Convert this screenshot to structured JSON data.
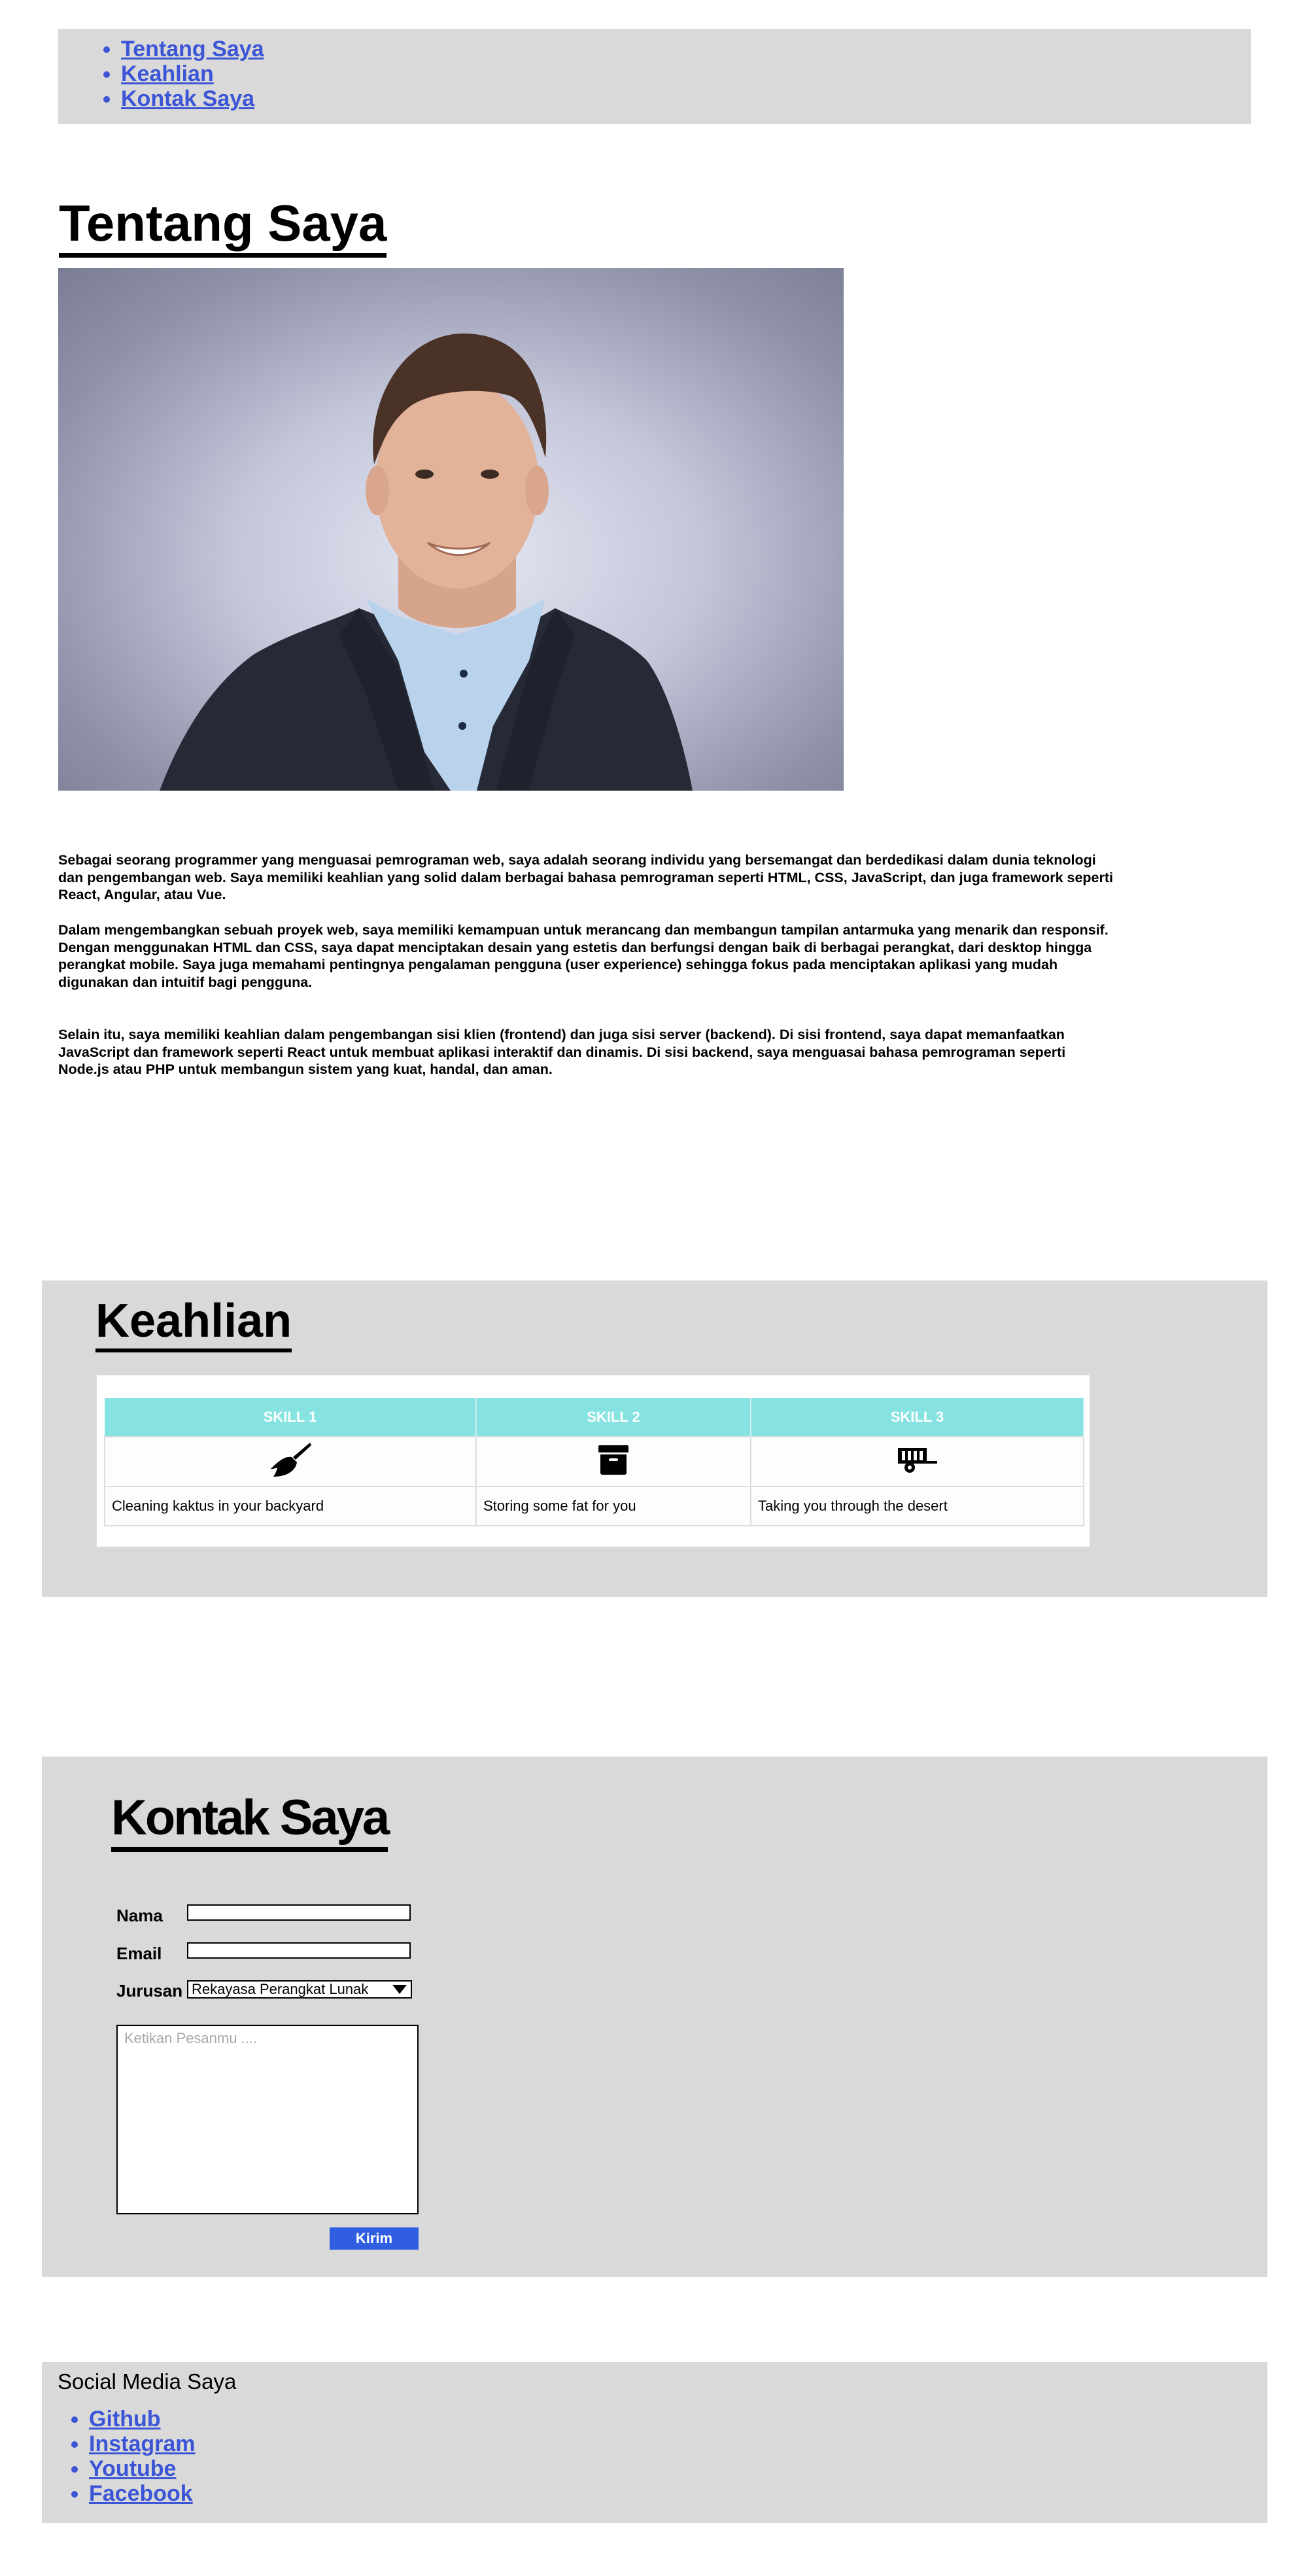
{
  "nav": {
    "items": [
      {
        "label": "Tentang Saya"
      },
      {
        "label": "Keahlian"
      },
      {
        "label": "Kontak Saya"
      }
    ]
  },
  "about": {
    "title": "Tentang Saya",
    "paragraphs": [
      "Sebagai seorang programmer yang menguasai pemrograman web, saya adalah seorang individu yang bersemangat dan berdedikasi dalam dunia teknologi dan pengembangan web. Saya memiliki keahlian yang solid dalam berbagai bahasa pemrograman seperti HTML, CSS, JavaScript, dan juga framework seperti React, Angular, atau Vue.",
      "Dalam mengembangkan sebuah proyek web, saya memiliki kemampuan untuk merancang dan membangun tampilan antarmuka yang menarik dan responsif. Dengan menggunakan HTML dan CSS, saya dapat menciptakan desain yang estetis dan berfungsi dengan baik di berbagai perangkat, dari desktop hingga perangkat mobile. Saya juga memahami pentingnya pengalaman pengguna (user experience) sehingga fokus pada menciptakan aplikasi yang mudah digunakan dan intuitif bagi pengguna.",
      "Selain itu, saya memiliki keahlian dalam pengembangan sisi klien (frontend) dan juga sisi server (backend). Di sisi frontend, saya dapat memanfaatkan JavaScript dan framework seperti React untuk membuat aplikasi interaktif dan dinamis. Di sisi backend, saya menguasai bahasa pemrograman seperti Node.js atau PHP untuk membangun sistem yang kuat, handal, dan aman."
    ]
  },
  "skills": {
    "title": "Keahlian",
    "header_color": "#86e3e1",
    "columns": [
      {
        "header": "SKILL 1",
        "icon": "broom-icon",
        "desc": "Cleaning kaktus in your backyard"
      },
      {
        "header": "SKILL 2",
        "icon": "archive-box-icon",
        "desc": "Storing some fat for you"
      },
      {
        "header": "SKILL 3",
        "icon": "trailer-icon",
        "desc": "Taking you through the desert"
      }
    ]
  },
  "contact": {
    "title": "Kontak Saya",
    "name_label": "Nama",
    "name_value": "",
    "email_label": "Email",
    "email_value": "",
    "major_label": "Jurusan",
    "major_selected": "Rekayasa Perangkat Lunak",
    "message_placeholder": "Ketikan Pesanmu ....",
    "submit_label": "Kirim",
    "submit_color": "#2f5fe0"
  },
  "social": {
    "title": "Social Media Saya",
    "links": [
      {
        "label": "Github"
      },
      {
        "label": "Instagram"
      },
      {
        "label": "Youtube"
      },
      {
        "label": "Facebook"
      }
    ]
  }
}
